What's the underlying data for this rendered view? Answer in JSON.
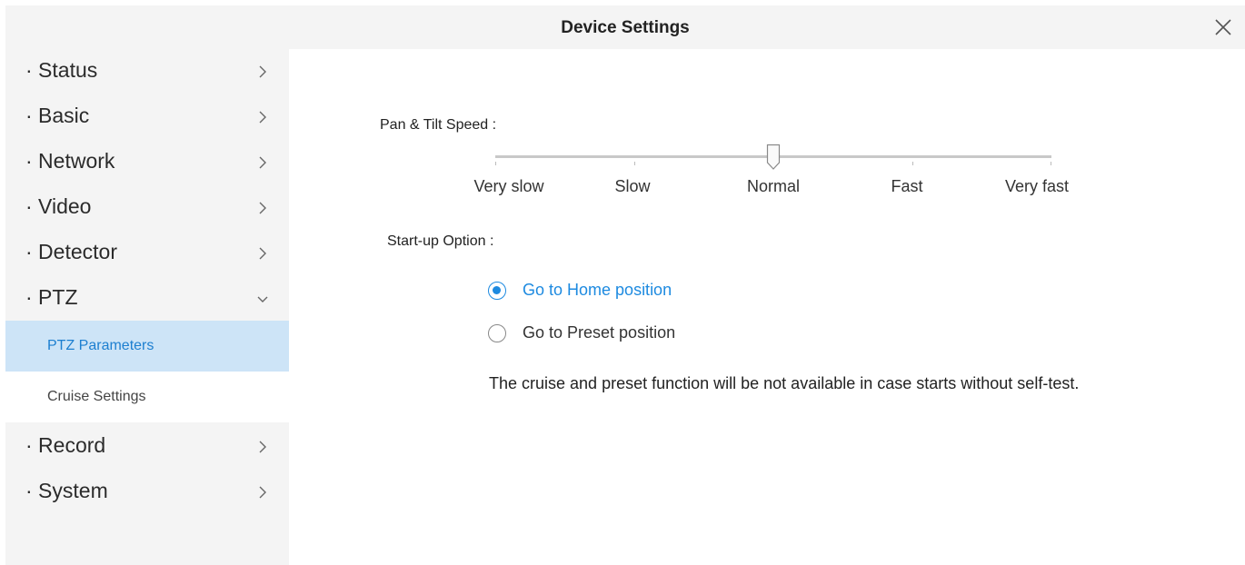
{
  "window": {
    "title": "Device Settings"
  },
  "sidebar": {
    "items": [
      {
        "label": "· Status",
        "chevron": "right"
      },
      {
        "label": "· Basic",
        "chevron": "right"
      },
      {
        "label": "· Network",
        "chevron": "right"
      },
      {
        "label": "· Video",
        "chevron": "right"
      },
      {
        "label": "· Detector",
        "chevron": "right"
      },
      {
        "label": "· PTZ",
        "chevron": "down"
      },
      {
        "label": "· Record",
        "chevron": "right"
      },
      {
        "label": "· System",
        "chevron": "right"
      }
    ],
    "ptz_subitems": [
      {
        "label": "PTZ Parameters",
        "active": true
      },
      {
        "label": "Cruise Settings",
        "active": false
      }
    ]
  },
  "main": {
    "speed_label": "Pan & Tilt Speed :",
    "speed_levels": [
      "Very slow",
      "Slow",
      "Normal",
      "Fast",
      "Very fast"
    ],
    "speed_selected_index": 2,
    "startup_label": "Start-up Option :",
    "startup_options": [
      {
        "label": "Go to Home position",
        "selected": true
      },
      {
        "label": "Go to Preset position",
        "selected": false
      }
    ],
    "note": "The cruise and preset function will be not available in case starts without self-test."
  },
  "colors": {
    "accent": "#1d8ae0",
    "active_bg": "#cde4f7",
    "panel_bg": "#f4f4f4"
  }
}
